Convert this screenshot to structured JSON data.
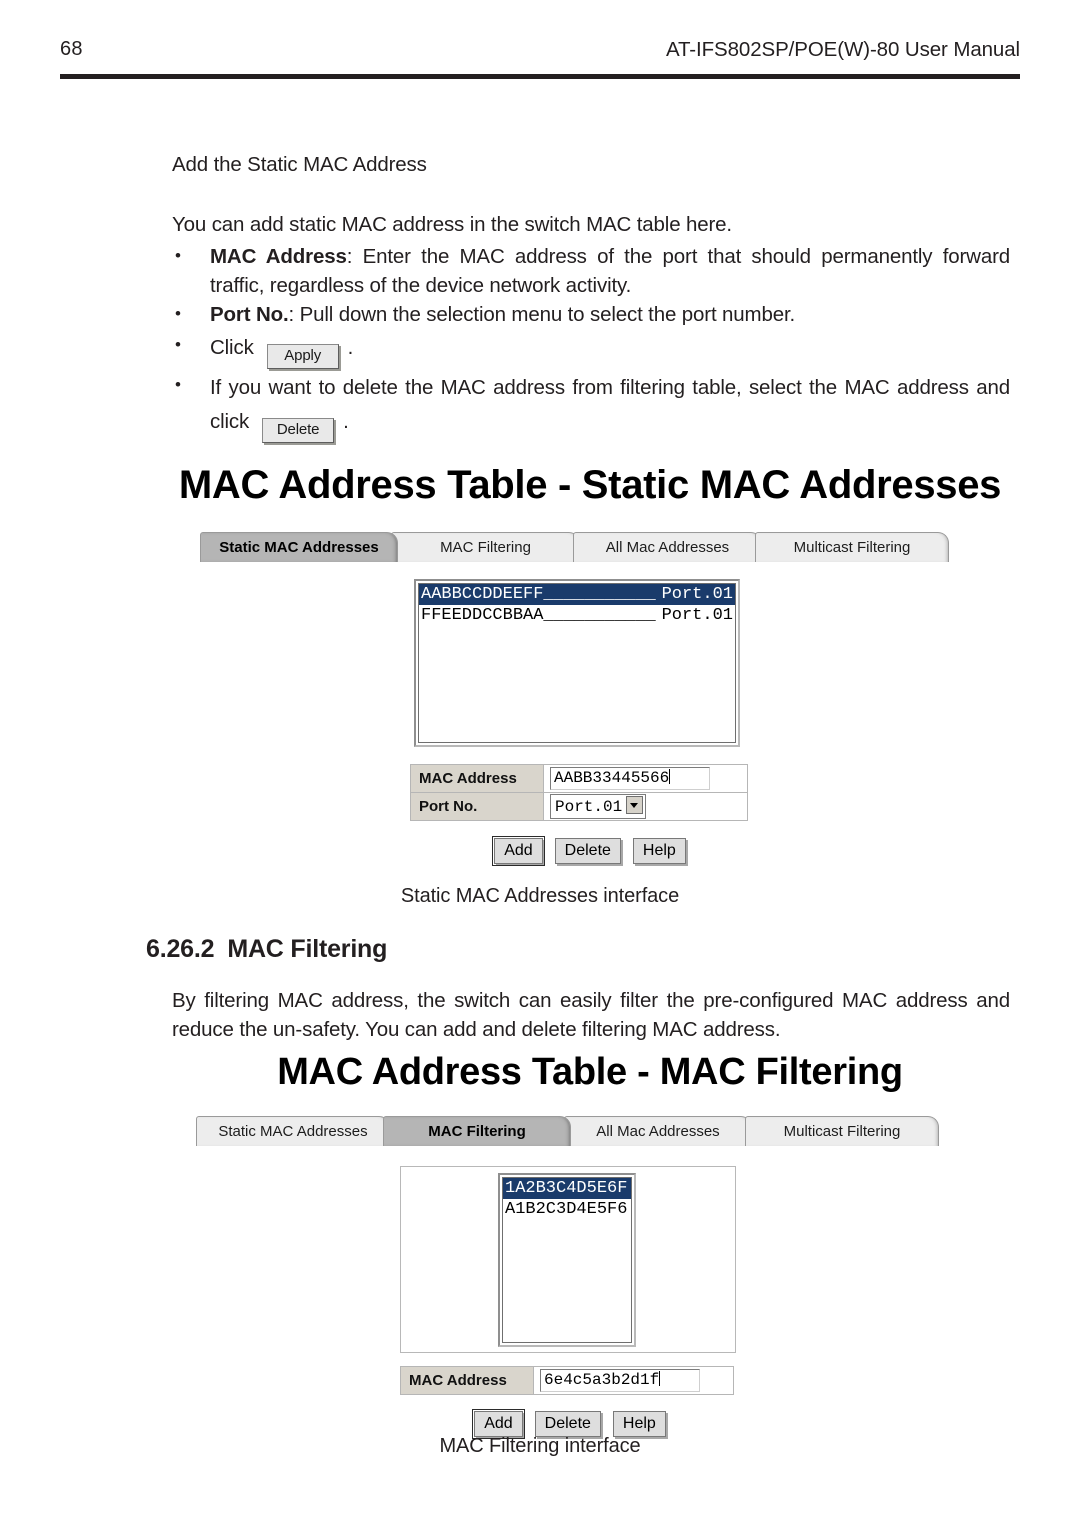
{
  "header": {
    "page_number": "68",
    "manual_title": "AT-IFS802SP/POE(W)-80 User Manual"
  },
  "body": {
    "subheading": "Add the Static MAC Address",
    "intro": "You can add static MAC address in the switch MAC table here.",
    "bullets": [
      {
        "term": "MAC Address",
        "text": ": Enter the MAC address of the port that should permanently forward traffic, regardless of the device network activity."
      },
      {
        "term": "Port No.",
        "text": ": Pull down the selection menu to select the port number."
      },
      {
        "pre": "Click",
        "button": "Apply",
        "post": "."
      },
      {
        "pre": "If you want to delete the MAC address from filtering table, select the MAC address and click",
        "button": "Delete",
        "post": "."
      }
    ]
  },
  "screenshot_static": {
    "title": "MAC Address Table - Static MAC Addresses",
    "tabs": [
      {
        "label": "Static MAC Addresses",
        "active": true
      },
      {
        "label": "MAC Filtering",
        "active": false
      },
      {
        "label": "All Mac Addresses",
        "active": false
      },
      {
        "label": "Multicast Filtering",
        "active": false
      }
    ],
    "list_items": [
      {
        "mac": "AABBCCDDEEFF",
        "pad": "___________",
        "port": "Port.01",
        "selected": true
      },
      {
        "mac": "FFEEDDCCBBAA",
        "pad": "___________",
        "port": "Port.01",
        "selected": false
      }
    ],
    "form": {
      "mac_label": "MAC Address",
      "mac_value": "AABB33445566",
      "port_label": "Port No.",
      "port_value": "Port.01"
    },
    "buttons": [
      {
        "label": "Add",
        "focused": true
      },
      {
        "label": "Delete",
        "focused": false
      },
      {
        "label": "Help",
        "focused": false
      }
    ],
    "caption": "Static MAC Addresses interface"
  },
  "section": {
    "number": "6.26.2",
    "title": "MAC Filtering",
    "paragraph": "By filtering MAC address, the switch can easily filter the pre-configured MAC address and reduce the un-safety. You can add and delete filtering MAC address."
  },
  "screenshot_filtering": {
    "title": "MAC Address Table - MAC Filtering",
    "tabs": [
      {
        "label": "Static MAC Addresses",
        "active": false
      },
      {
        "label": "MAC Filtering",
        "active": true
      },
      {
        "label": "All Mac Addresses",
        "active": false
      },
      {
        "label": "Multicast Filtering",
        "active": false
      }
    ],
    "list_items": [
      {
        "mac": "1A2B3C4D5E6F",
        "selected": true
      },
      {
        "mac": "A1B2C3D4E5F6",
        "selected": false
      }
    ],
    "form": {
      "mac_label": "MAC Address",
      "mac_value": "6e4c5a3b2d1f"
    },
    "buttons": [
      {
        "label": "Add",
        "focused": true
      },
      {
        "label": "Delete",
        "focused": false
      },
      {
        "label": "Help",
        "focused": false
      }
    ],
    "caption": "MAC Filtering interface"
  },
  "colors": {
    "selection_blue": "#1a3b6b",
    "tab_active_gray": "#b5b5b5",
    "tab_gray": "#ededed",
    "form_label_gray": "#d9d5cc",
    "ink": "#231f20"
  }
}
